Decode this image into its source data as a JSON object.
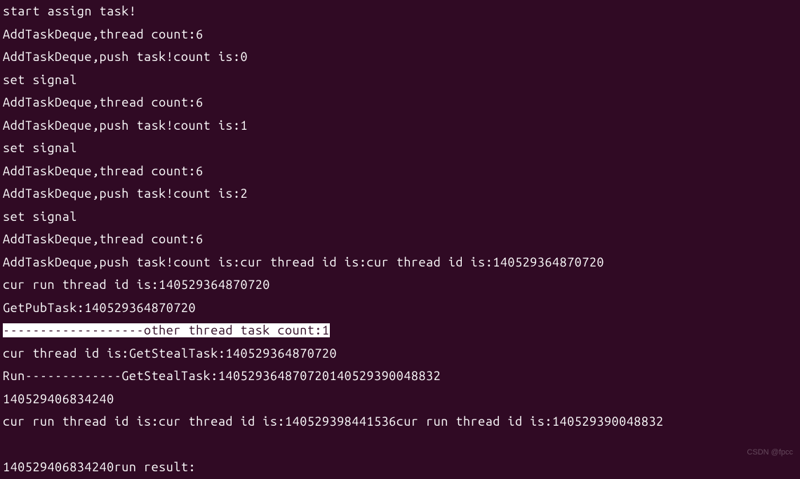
{
  "terminal": {
    "lines": [
      {
        "text": "start assign task!",
        "highlighted": false
      },
      {
        "text": "AddTaskDeque,thread count:6",
        "highlighted": false
      },
      {
        "text": "AddTaskDeque,push task!count is:0",
        "highlighted": false
      },
      {
        "text": "set signal",
        "highlighted": false
      },
      {
        "text": "AddTaskDeque,thread count:6",
        "highlighted": false
      },
      {
        "text": "AddTaskDeque,push task!count is:1",
        "highlighted": false
      },
      {
        "text": "set signal",
        "highlighted": false
      },
      {
        "text": "AddTaskDeque,thread count:6",
        "highlighted": false
      },
      {
        "text": "AddTaskDeque,push task!count is:2",
        "highlighted": false
      },
      {
        "text": "set signal",
        "highlighted": false
      },
      {
        "text": "AddTaskDeque,thread count:6",
        "highlighted": false
      },
      {
        "text": "AddTaskDeque,push task!count is:cur thread id is:cur thread id is:140529364870720",
        "highlighted": false
      },
      {
        "text": "cur run thread id is:140529364870720",
        "highlighted": false
      },
      {
        "text": "GetPubTask:140529364870720",
        "highlighted": false
      },
      {
        "text": "-------------------other thread task count:1",
        "highlighted": true
      },
      {
        "text": "cur thread id is:GetStealTask:140529364870720",
        "highlighted": false
      },
      {
        "text": "Run-------------GetStealTask:140529364870720140529390048832",
        "highlighted": false
      },
      {
        "text": "140529406834240",
        "highlighted": false
      },
      {
        "text": "cur run thread id is:cur thread id is:140529398441536cur run thread id is:140529390048832",
        "highlighted": false
      },
      {
        "text": "",
        "highlighted": false
      },
      {
        "text": "140529406834240run result:",
        "highlighted": false
      }
    ]
  },
  "watermark": "CSDN @fpcc"
}
